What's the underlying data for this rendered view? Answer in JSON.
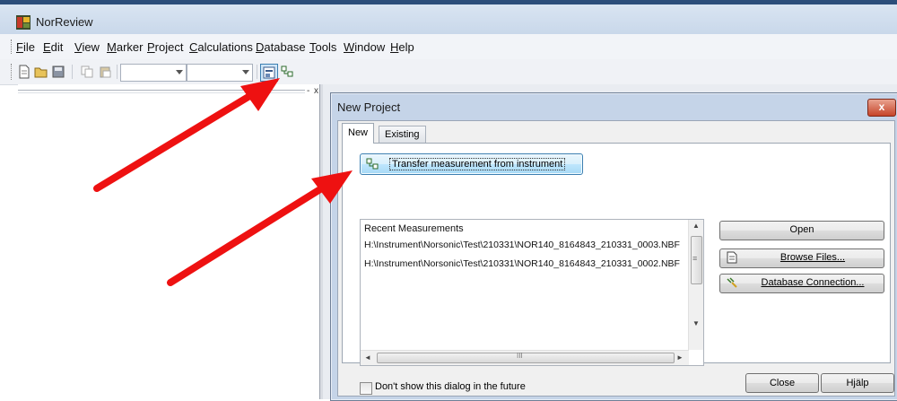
{
  "window": {
    "title": "NorReview"
  },
  "menu": {
    "items": [
      "File",
      "Edit",
      "View",
      "Marker",
      "Project",
      "Calculations",
      "Database",
      "Tools",
      "Window",
      "Help"
    ],
    "mnemonics": [
      "F",
      "E",
      "V",
      "M",
      "P",
      "C",
      "D",
      "T",
      "W",
      "H"
    ]
  },
  "toolbar": {
    "icons": [
      "new-document-icon",
      "open-folder-icon",
      "save-icon",
      "copy-icon",
      "paste-icon"
    ],
    "combo1_value": "",
    "combo2_value": "",
    "highlight_icons": [
      "project-window-icon",
      "transfer-instrument-icon"
    ]
  },
  "left_pane": {
    "pin_glyph": "-",
    "close_glyph": "x"
  },
  "dialog": {
    "title": "New Project",
    "close_glyph": "x",
    "tabs": [
      "New",
      "Existing"
    ],
    "active_tab": "New",
    "transfer_button": "Transfer measurement from instrument",
    "recent": {
      "header": "Recent Measurements",
      "items": [
        "H:\\Instrument\\Norsonic\\Test\\210331\\NOR140_8164843_210331_0003.NBF",
        "H:\\Instrument\\Norsonic\\Test\\210331\\NOR140_8164843_210331_0002.NBF"
      ],
      "scroll_left": "◄",
      "scroll_right": "►",
      "scroll_up": "▲",
      "scroll_down": "▼",
      "hscroll_grip": "III",
      "vscroll_grip": "≡"
    },
    "open_button": "Open",
    "browse_button": "Browse Files...",
    "database_button": "Database Connection...",
    "dont_show": "Don't show this dialog in the future",
    "close_button": "Close",
    "help_button": "Hjälp"
  },
  "colors": {
    "arrow": "#ee1111",
    "dialog_frame": "#c5d4e8",
    "close_red": "#c6452a"
  }
}
